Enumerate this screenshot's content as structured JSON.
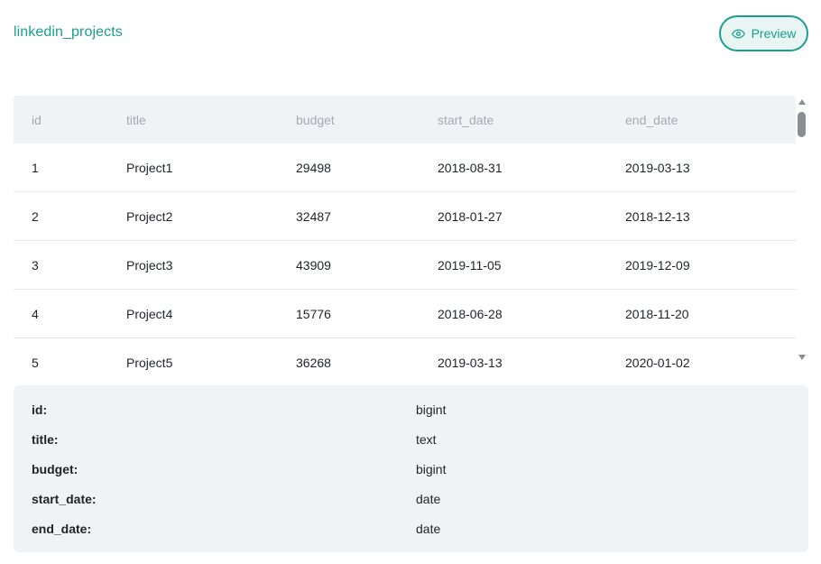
{
  "header": {
    "table_name": "linkedin_projects",
    "preview_label": "Preview",
    "preview_icon": "eye-icon"
  },
  "colors": {
    "accent": "#1a9e8f",
    "accent_bg": "#e8f5f3",
    "header_bg": "#f0f3f6",
    "header_text": "#a3aab2"
  },
  "grid": {
    "columns": [
      "id",
      "title",
      "budget",
      "start_date",
      "end_date"
    ],
    "rows": [
      [
        "1",
        "Project1",
        "29498",
        "2018-08-31",
        "2019-03-13"
      ],
      [
        "2",
        "Project2",
        "32487",
        "2018-01-27",
        "2018-12-13"
      ],
      [
        "3",
        "Project3",
        "43909",
        "2019-11-05",
        "2019-12-09"
      ],
      [
        "4",
        "Project4",
        "15776",
        "2018-06-28",
        "2018-11-20"
      ],
      [
        "5",
        "Project5",
        "36268",
        "2019-03-13",
        "2020-01-02"
      ]
    ]
  },
  "schema": {
    "fields": [
      {
        "name": "id:",
        "type": "bigint"
      },
      {
        "name": "title:",
        "type": "text"
      },
      {
        "name": "budget:",
        "type": "bigint"
      },
      {
        "name": "start_date:",
        "type": "date"
      },
      {
        "name": "end_date:",
        "type": "date"
      }
    ]
  }
}
